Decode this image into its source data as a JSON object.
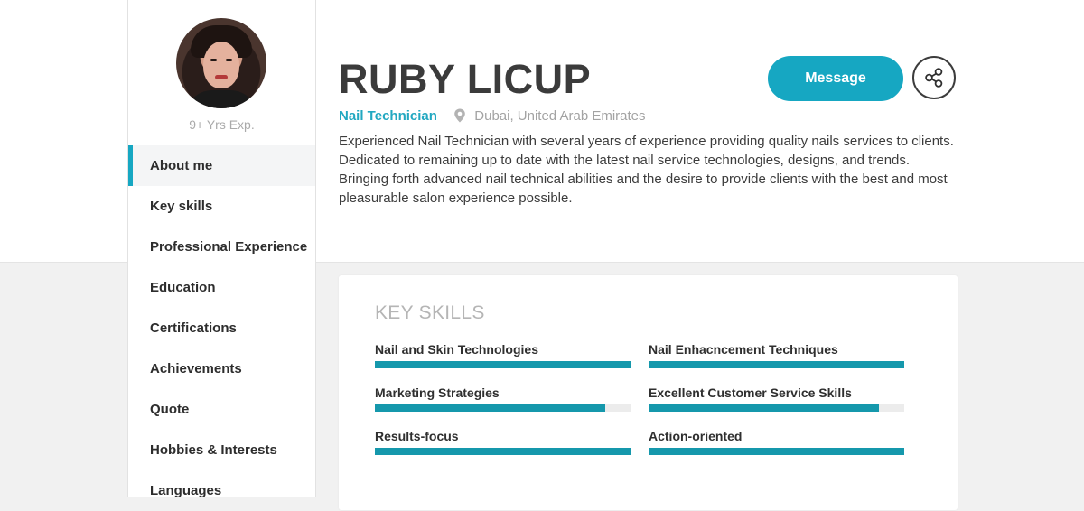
{
  "profile": {
    "experience": "9+ Yrs Exp.",
    "name": "RUBY LICUP",
    "role": "Nail Technician",
    "location": "Dubai, United Arab Emirates",
    "bio": "Experienced Nail Technician with several years of experience providing quality nails services to clients. Dedicated to remaining up to date with the latest nail service technologies, designs, and trends. Bringing forth advanced nail technical abilities and the desire to provide clients with the best and most pleasurable salon experience possible."
  },
  "actions": {
    "message_label": "Message",
    "share_icon": "share-icon"
  },
  "sidebar": {
    "items": [
      {
        "label": "About me",
        "active": true
      },
      {
        "label": "Key skills"
      },
      {
        "label": "Professional Experience"
      },
      {
        "label": "Education"
      },
      {
        "label": "Certifications"
      },
      {
        "label": "Achievements"
      },
      {
        "label": "Quote"
      },
      {
        "label": "Hobbies & Interests"
      },
      {
        "label": "Languages"
      }
    ]
  },
  "key_skills": {
    "title": "KEY SKILLS",
    "skills": [
      {
        "label": "Nail and Skin Technologies",
        "level": 1.0
      },
      {
        "label": "Nail Enhacncement Techniques",
        "level": 1.0
      },
      {
        "label": "Marketing Strategies",
        "level": 0.9
      },
      {
        "label": "Excellent Customer Service Skills",
        "level": 0.9
      },
      {
        "label": "Results-focus",
        "level": 1.0
      },
      {
        "label": "Action-oriented",
        "level": 1.0
      }
    ]
  },
  "colors": {
    "accent": "#16a7c2",
    "skill_bar": "#1598ac"
  }
}
